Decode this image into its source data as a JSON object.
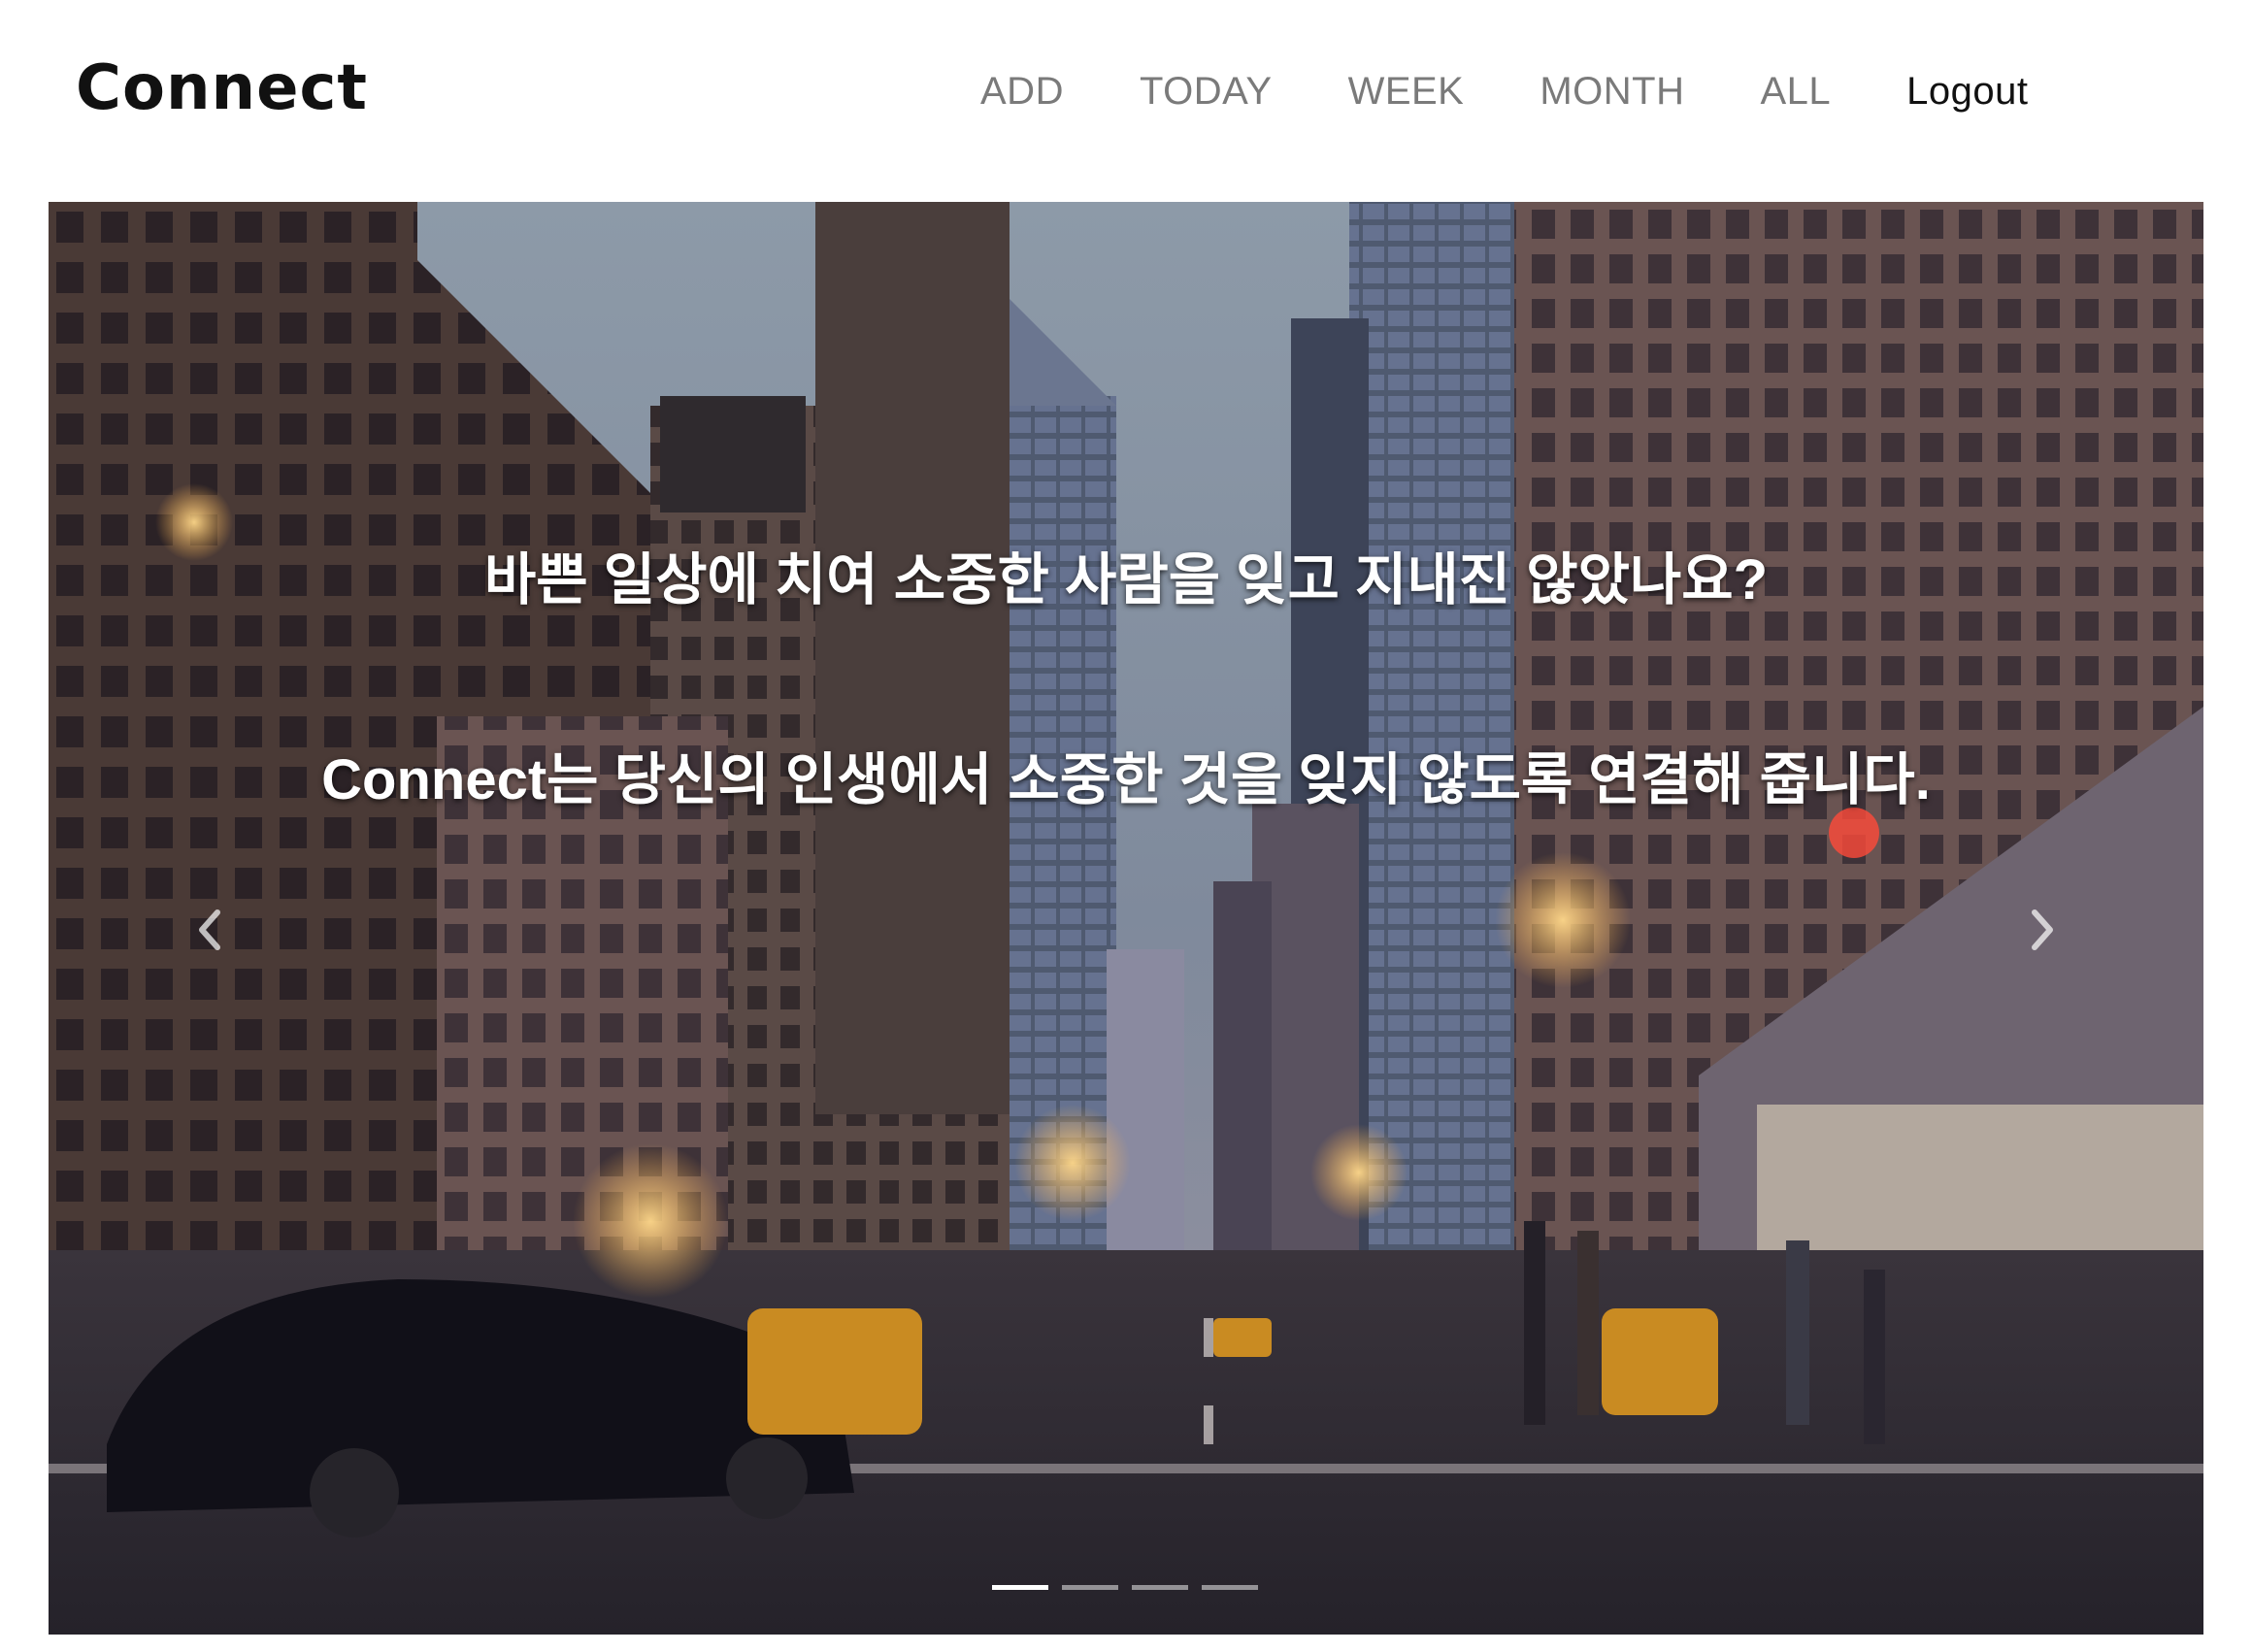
{
  "header": {
    "logo": "Connect",
    "nav": {
      "add": "ADD",
      "today": "TODAY",
      "week": "WEEK",
      "month": "MONTH",
      "all": "ALL",
      "logout": "Logout"
    }
  },
  "carousel": {
    "caption_line1": "바쁜 일상에 치여 소중한 사람을 잊고 지내진 않았나요?",
    "caption_line2": "Connect는 당신의 인생에서 소중한 것을 잊지 않도록 연결해 줍니다.",
    "prev_icon": "chevron-left-icon",
    "next_icon": "chevron-right-icon",
    "indicator_count": 4,
    "active_indicator": 0
  },
  "colors": {
    "nav_text": "#7a7a7a",
    "logout_text": "#111111",
    "caption_text": "#ffffff"
  }
}
